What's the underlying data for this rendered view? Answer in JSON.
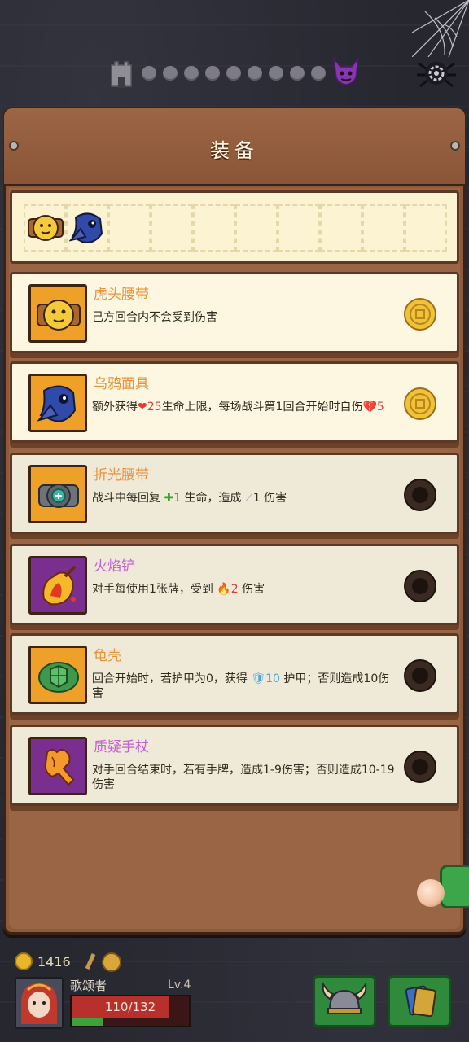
{
  "panel": {
    "title": "装备"
  },
  "items": [
    {
      "name": "虎头腰带",
      "desc_parts": [
        "己方回合内不会受到伤害"
      ],
      "rarity": "orange",
      "status": "coin",
      "icon": "tiger-belt-icon"
    },
    {
      "name": "乌鸦面具",
      "desc_parts": [
        "额外获得",
        "❤",
        "25",
        "生命上限，每场战斗第1回合开始时自伤",
        "💔",
        "5"
      ],
      "rarity": "orange",
      "status": "coin",
      "icon": "crow-mask-icon"
    },
    {
      "name": "折光腰带",
      "desc_parts": [
        "战斗中每回复 ",
        "✚",
        "1",
        " 生命，造成 ",
        "1 伤害"
      ],
      "rarity": "orange",
      "status": "empty",
      "icon": "refraction-belt-icon"
    },
    {
      "name": "火焰铲",
      "desc_parts": [
        "对手每使用1张牌，受到 ",
        "🔥",
        "2",
        " 伤害"
      ],
      "rarity": "purple",
      "status": "empty",
      "icon": "flame-shovel-icon"
    },
    {
      "name": "龟壳",
      "desc_parts": [
        "回合开始时，若护甲为0，获得 ",
        "🛡",
        "10",
        " 护甲；否则造成10伤害"
      ],
      "rarity": "orange",
      "status": "empty",
      "icon": "turtle-shell-icon"
    },
    {
      "name": "质疑手杖",
      "desc_parts": [
        "对手回合结束时，若有手牌，造成1-9伤害；否则造成10-19伤害"
      ],
      "rarity": "purple",
      "status": "empty",
      "icon": "doubt-cane-icon"
    }
  ],
  "player": {
    "gold": "1416",
    "name": "歌颂者",
    "level": "Lv.4",
    "hp_text": "110/132",
    "hp_fraction": 0.833,
    "xp_fraction": 0.27
  },
  "colors": {
    "orange_name": "#e8923a",
    "purple_name": "#c55fd6",
    "hp": "#b8302c",
    "xp": "#3ea13a"
  }
}
